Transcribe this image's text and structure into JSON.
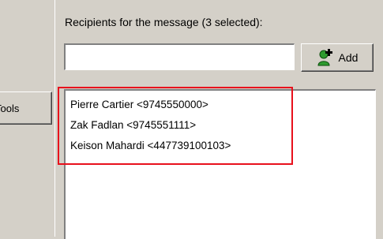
{
  "tools_button": {
    "label": "Tools"
  },
  "recipients": {
    "heading": "Recipients for the message (3 selected):",
    "input_value": "",
    "add_label": "Add",
    "items": [
      {
        "label": "Pierre Cartier <9745550000>"
      },
      {
        "label": "Zak Fadlan <9745551111>"
      },
      {
        "label": "Keison Mahardi <447739100103>"
      }
    ]
  },
  "colors": {
    "window_bg": "#d4d0c8",
    "highlight_border": "#e8101c",
    "list_bg": "#ffffff"
  }
}
